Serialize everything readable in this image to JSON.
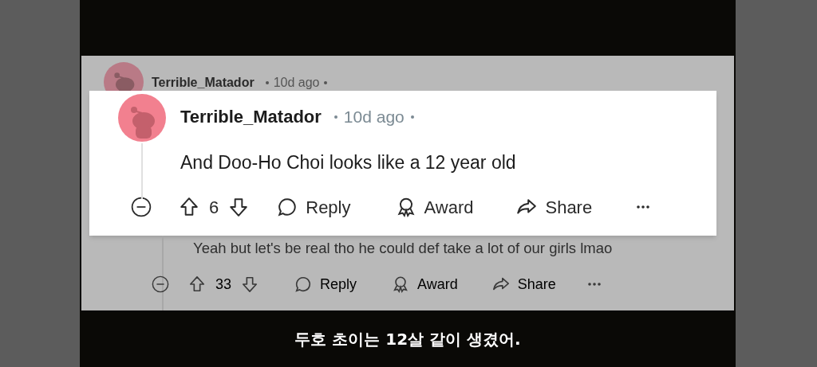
{
  "background_comment": {
    "author": "Terrible_Matador",
    "age": "10d ago"
  },
  "highlighted_comment": {
    "author": "Terrible_Matador",
    "age": "10d ago",
    "body": "And Doo-Ho Choi looks like a 12 year old",
    "score": "6",
    "actions": [
      {
        "kind": "reply",
        "label": "Reply"
      },
      {
        "kind": "award",
        "label": "Award"
      },
      {
        "kind": "share",
        "label": "Share"
      }
    ]
  },
  "reply": {
    "body": "Yeah but let's be real tho he could def take a lot of our girls lmao",
    "score": "33",
    "actions": [
      {
        "kind": "reply",
        "label": "Reply"
      },
      {
        "kind": "award",
        "label": "Award"
      },
      {
        "kind": "share",
        "label": "Share"
      }
    ]
  },
  "subtitle": "두호 초이는 12살 같이 생겼어."
}
